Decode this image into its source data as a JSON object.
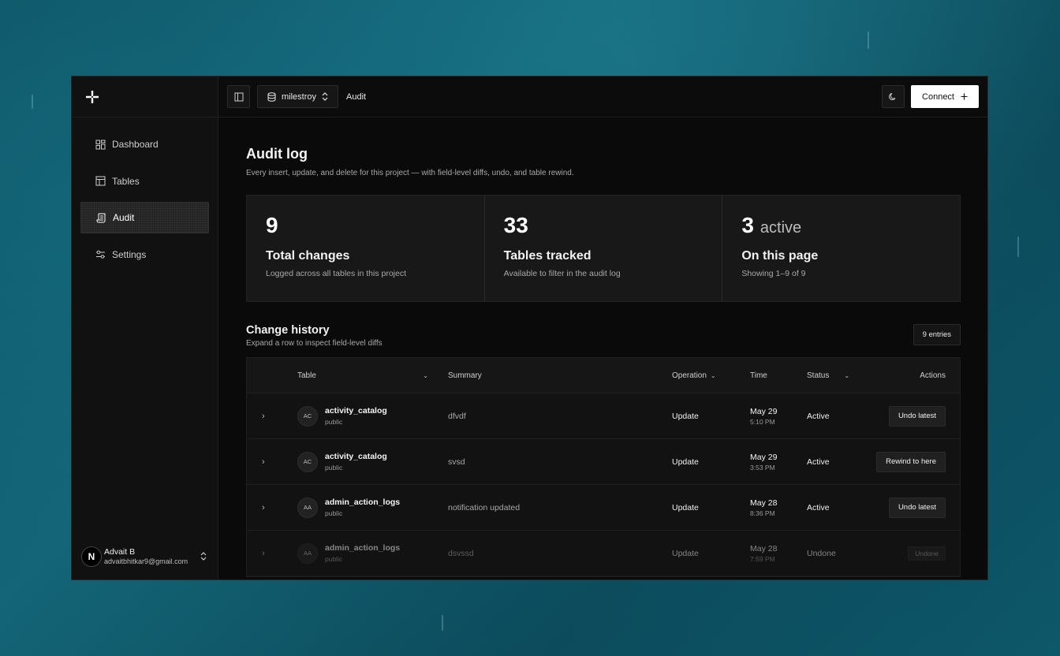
{
  "sidebar": {
    "items": [
      {
        "label": "Dashboard",
        "icon": "dashboard-icon"
      },
      {
        "label": "Tables",
        "icon": "table-icon"
      },
      {
        "label": "Audit",
        "icon": "audit-scroll-icon",
        "active": true
      },
      {
        "label": "Settings",
        "icon": "sliders-icon"
      }
    ],
    "user": {
      "initial": "N",
      "name": "Advait B",
      "email": "advaitbhitkar9@gmail.com"
    }
  },
  "topbar": {
    "project": "milestroy",
    "breadcrumb": "Audit",
    "connect_label": "Connect"
  },
  "page": {
    "title": "Audit log",
    "subtitle": "Every insert, update, and delete for this project — with field-level diffs, undo, and table rewind."
  },
  "stats": [
    {
      "value": "9",
      "suffix": "",
      "label": "Total changes",
      "desc": "Logged across all tables in this project"
    },
    {
      "value": "33",
      "suffix": "",
      "label": "Tables tracked",
      "desc": "Available to filter in the audit log"
    },
    {
      "value": "3",
      "suffix": "active",
      "label": "On this page",
      "desc": "Showing 1–9 of 9"
    }
  ],
  "history": {
    "title": "Change history",
    "subtitle": "Expand a row to inspect field-level diffs",
    "entries_badge": "9 entries",
    "columns": {
      "table": "Table",
      "summary": "Summary",
      "operation": "Operation",
      "time": "Time",
      "status": "Status",
      "actions": "Actions"
    },
    "rows": [
      {
        "abbr": "AC",
        "table": "activity_catalog",
        "schema": "public",
        "summary": "dfvdf",
        "operation": "Update",
        "date": "May 29",
        "time": "5:10 PM",
        "status": "Active",
        "action": "Undo latest"
      },
      {
        "abbr": "AC",
        "table": "activity_catalog",
        "schema": "public",
        "summary": "svsd",
        "operation": "Update",
        "date": "May 29",
        "time": "3:53 PM",
        "status": "Active",
        "action": "Rewind to here"
      },
      {
        "abbr": "AA",
        "table": "admin_action_logs",
        "schema": "public",
        "summary": "notification updated",
        "operation": "Update",
        "date": "May 28",
        "time": "8:36 PM",
        "status": "Active",
        "action": "Undo latest"
      },
      {
        "abbr": "AA",
        "table": "admin_action_logs",
        "schema": "public",
        "summary": "dsvssd",
        "operation": "Update",
        "date": "May 28",
        "time": "7:59 PM",
        "status": "Undone",
        "action": "Undone"
      }
    ]
  },
  "colors": {
    "accent": "#ffffff",
    "surface": "#0a0a0a",
    "backdrop": "#136577"
  }
}
